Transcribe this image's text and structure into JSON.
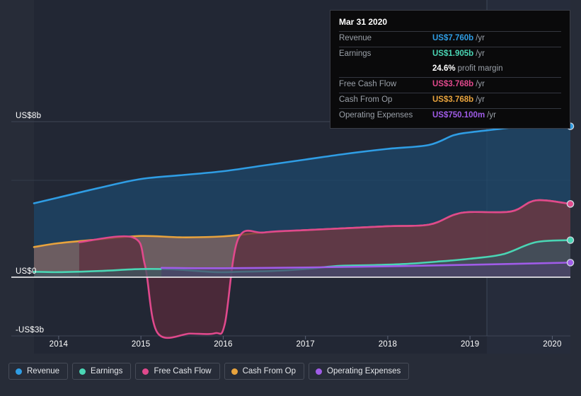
{
  "theme": {
    "background": "#272c38",
    "plot_background": "#222734",
    "zero_line": "#ffffff",
    "grid": "#3a4050",
    "axis_text": "#ffffff"
  },
  "tooltip": {
    "title": "Mar 31 2020",
    "rows": [
      {
        "label": "Revenue",
        "value": "US$7.760b",
        "suffix": "/yr",
        "color": "#2f9de4"
      },
      {
        "label": "Earnings",
        "value": "US$1.905b",
        "suffix": "/yr",
        "color": "#4ad5b4"
      },
      {
        "label": "",
        "value": "24.6%",
        "suffix": "profit margin",
        "color": "#ffffff"
      },
      {
        "label": "Free Cash Flow",
        "value": "US$3.768b",
        "suffix": "/yr",
        "color": "#e0498c"
      },
      {
        "label": "Cash From Op",
        "value": "US$3.768b",
        "suffix": "/yr",
        "color": "#e8a33d"
      },
      {
        "label": "Operating Expenses",
        "value": "US$750.100m",
        "suffix": "/yr",
        "color": "#a05ce8"
      }
    ]
  },
  "legend": {
    "items": [
      {
        "label": "Revenue",
        "color": "#2f9de4"
      },
      {
        "label": "Earnings",
        "color": "#4ad5b4"
      },
      {
        "label": "Free Cash Flow",
        "color": "#e0498c"
      },
      {
        "label": "Cash From Op",
        "color": "#e8a33d"
      },
      {
        "label": "Operating Expenses",
        "color": "#a05ce8"
      }
    ]
  },
  "chart_data": {
    "type": "area",
    "title": "",
    "xlabel": "",
    "ylabel": "",
    "ylim": [
      -3,
      8
    ],
    "yticks": [
      8,
      0,
      -3
    ],
    "ytick_labels": [
      "US$8b",
      "US$0",
      "-US$3b"
    ],
    "grid": true,
    "legend_position": "bottom",
    "x": [
      2013.7,
      2014,
      2015,
      2016,
      2017,
      2018,
      2019,
      2020.22
    ],
    "xticks": [
      2014,
      2015,
      2016,
      2017,
      2018,
      2019,
      2020
    ],
    "xtick_labels": [
      "2014",
      "2015",
      "2016",
      "2017",
      "2018",
      "2019",
      "2020"
    ],
    "units": "US$ billions per year",
    "series": [
      {
        "name": "Revenue",
        "color": "#2f9de4",
        "fill": "#1d4a6e",
        "x": [
          2013.7,
          2014.0,
          2014.5,
          2015.0,
          2015.5,
          2016.0,
          2016.5,
          2017.0,
          2017.5,
          2018.0,
          2018.5,
          2018.8,
          2019.0,
          2019.5,
          2019.8,
          2020.22
        ],
        "values": [
          3.8,
          4.1,
          4.6,
          5.05,
          5.25,
          5.45,
          5.75,
          6.05,
          6.35,
          6.6,
          6.8,
          7.3,
          7.45,
          7.7,
          7.95,
          7.76
        ]
      },
      {
        "name": "Cash From Op",
        "color": "#e8a33d",
        "fill": "#8a6a63",
        "x": [
          2013.7,
          2014.0,
          2014.5,
          2015.0,
          2015.5,
          2016.0,
          2016.5,
          2017.0,
          2017.5,
          2018.0,
          2018.5,
          2018.8,
          2019.0,
          2019.5,
          2019.8,
          2020.22
        ],
        "values": [
          1.55,
          1.75,
          1.95,
          2.12,
          2.05,
          2.1,
          2.3,
          2.42,
          2.52,
          2.62,
          2.7,
          3.2,
          3.35,
          3.38,
          3.95,
          3.768
        ]
      },
      {
        "name": "Free Cash Flow",
        "color": "#e0498c",
        "fill": "#5a2b3c",
        "x": [
          2014.25,
          2014.9,
          2015.05,
          2015.2,
          2015.6,
          2015.9,
          2016.02,
          2016.18,
          2016.5,
          2017.0,
          2017.5,
          2018.0,
          2018.5,
          2018.8,
          2019.0,
          2019.5,
          2019.8,
          2020.22
        ],
        "values": [
          1.8,
          2.05,
          0.6,
          -2.85,
          -2.9,
          -2.88,
          -2.4,
          1.95,
          2.3,
          2.42,
          2.52,
          2.62,
          2.7,
          3.2,
          3.35,
          3.38,
          3.95,
          3.768
        ]
      },
      {
        "name": "Earnings",
        "color": "#4ad5b4",
        "fill": "#3a5560",
        "x": [
          2013.7,
          2014.0,
          2014.5,
          2015.0,
          2015.4,
          2015.9,
          2016.2,
          2016.6,
          2017.0,
          2017.4,
          2017.8,
          2018.2,
          2018.6,
          2019.0,
          2019.4,
          2019.8,
          2020.22
        ],
        "values": [
          0.28,
          0.26,
          0.32,
          0.42,
          0.4,
          0.26,
          0.28,
          0.32,
          0.42,
          0.58,
          0.62,
          0.68,
          0.8,
          0.95,
          1.18,
          1.8,
          1.905
        ]
      },
      {
        "name": "Operating Expenses",
        "color": "#a05ce8",
        "fill": "#4a4269",
        "x": [
          2015.25,
          2016.0,
          2017.0,
          2018.0,
          2019.0,
          2020.22
        ],
        "values": [
          0.48,
          0.46,
          0.5,
          0.56,
          0.64,
          0.7501
        ]
      }
    ]
  }
}
